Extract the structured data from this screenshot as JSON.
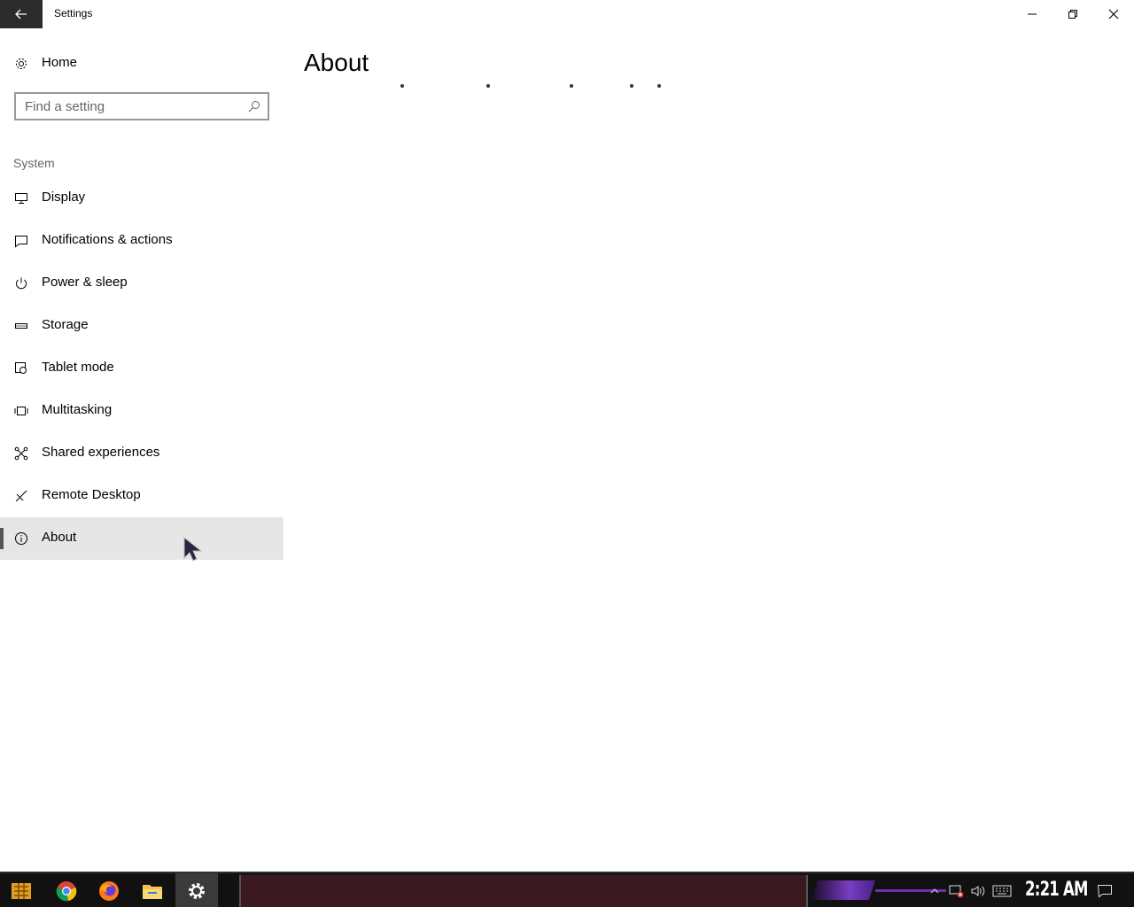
{
  "window": {
    "title": "Settings"
  },
  "sidebar": {
    "home_label": "Home",
    "search_placeholder": "Find a setting",
    "section_label": "System",
    "items": [
      {
        "label": "Display",
        "icon": "display-icon"
      },
      {
        "label": "Notifications & actions",
        "icon": "notifications-icon"
      },
      {
        "label": "Power & sleep",
        "icon": "power-icon"
      },
      {
        "label": "Storage",
        "icon": "storage-icon"
      },
      {
        "label": "Tablet mode",
        "icon": "tablet-mode-icon"
      },
      {
        "label": "Multitasking",
        "icon": "multitasking-icon"
      },
      {
        "label": "Shared experiences",
        "icon": "shared-experiences-icon"
      },
      {
        "label": "Remote Desktop",
        "icon": "remote-desktop-icon"
      },
      {
        "label": "About",
        "icon": "info-icon",
        "selected": true
      }
    ]
  },
  "content": {
    "title": "About"
  },
  "taskbar": {
    "clock": "2:21 AM",
    "apps": [
      "start-icon",
      "chrome-icon",
      "firefox-icon",
      "file-explorer-icon",
      "settings-icon"
    ],
    "active_app": "settings-icon"
  },
  "colors": {
    "selected_bg": "#e6e6e6",
    "titlebar_back_bg": "#2b2b2b",
    "taskbar_bg": "#111111",
    "accent_purple": "#7a3ec4"
  }
}
